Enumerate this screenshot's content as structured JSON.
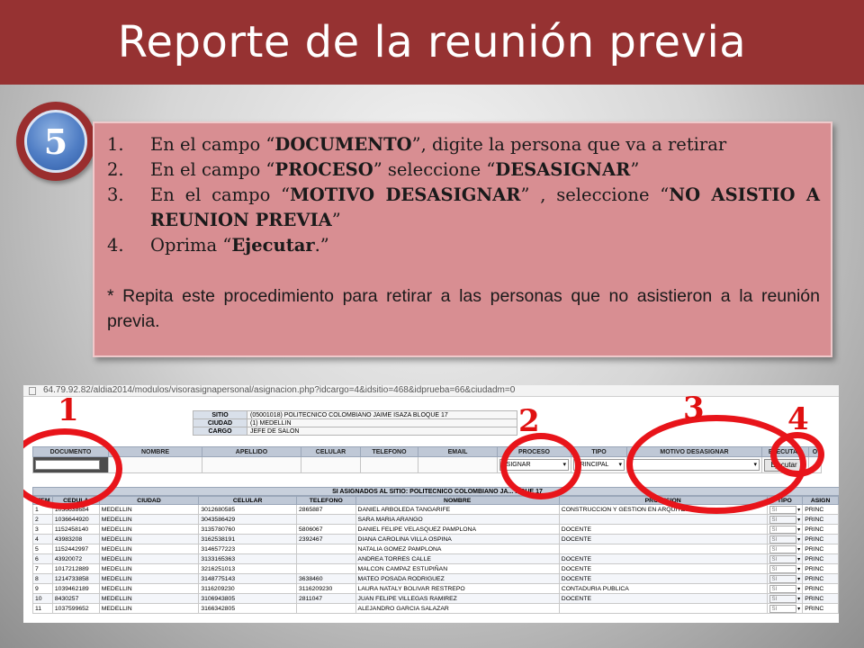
{
  "slide": {
    "title": "Reporte de la reunión previa",
    "step_number": "5"
  },
  "instructions": {
    "items": [
      {
        "num": "1.",
        "parts": [
          {
            "t": "En el campo “",
            "b": false
          },
          {
            "t": "DOCUMENTO",
            "b": true
          },
          {
            "t": "”, digite la persona que va a retirar",
            "b": false
          }
        ]
      },
      {
        "num": "2.",
        "parts": [
          {
            "t": "En el campo “",
            "b": false
          },
          {
            "t": "PROCESO",
            "b": true
          },
          {
            "t": "” seleccione “",
            "b": false
          },
          {
            "t": "DESASIGNAR",
            "b": true
          },
          {
            "t": "”",
            "b": false
          }
        ]
      },
      {
        "num": "3.",
        "parts": [
          {
            "t": "En el campo “",
            "b": false
          },
          {
            "t": "MOTIVO DESASIGNAR",
            "b": true
          },
          {
            "t": "” , seleccione “",
            "b": false
          },
          {
            "t": "NO ASISTIO A REUNION PREVIA",
            "b": true
          },
          {
            "t": "”",
            "b": false
          }
        ]
      },
      {
        "num": "4.",
        "parts": [
          {
            "t": "Oprima “",
            "b": false
          },
          {
            "t": "Ejecutar",
            "b": true
          },
          {
            "t": ".”",
            "b": false
          }
        ]
      }
    ],
    "note": "* Repita este procedimiento para retirar a las personas que no asistieron a la reunión previa."
  },
  "screenshot": {
    "url": "64.79.92.82/aldia2014/modulos/visorasignapersonal/asignacion.php?idcargo=4&idsitio=468&idprueba=66&ciudadm=0",
    "info": [
      {
        "label": "SITIO",
        "value": "(05001018) POLITECNICO COLOMBIANO JAIME ISAZA BLOQUE 17"
      },
      {
        "label": "CIUDAD",
        "value": "(1) MEDELLIN"
      },
      {
        "label": "CARGO",
        "value": "JEFE DE SALON"
      }
    ],
    "form_headers": [
      "DOCUMENTO",
      "NOMBRE",
      "APELLIDO",
      "CELULAR",
      "TELEFONO",
      "EMAIL",
      "PROCESO",
      "TIPO",
      "MOTIVO DESASIGNAR",
      "EJECUTAR",
      "O"
    ],
    "proceso_value": "ASIGNAR",
    "tipo_value": "PRINCIPAL",
    "execute_label": "Ejecutar",
    "list_title": "SI ASIGNADOS AL SITIO: POLITECNICO COLOMBIANO JA... ...QUE 17",
    "list_headers": [
      "ITEM",
      "CEDULA",
      "CIUDAD",
      "CELULAR",
      "TELEFONO",
      "NOMBRE",
      "PROFESION",
      "TIPO",
      "ASIGN"
    ],
    "rows": [
      [
        "1",
        "1036638684",
        "MEDELLIN",
        "3012680585",
        "2865887",
        "DANIEL ARBOLEDA TANGARIFE",
        "CONSTRUCCION Y GESTION EN ARQUITECTURA",
        "SI",
        "PRINC"
      ],
      [
        "2",
        "1036644920",
        "MEDELLIN",
        "3043586429",
        "",
        "SARA MARIA ARANGO",
        "",
        "SI",
        "PRINC"
      ],
      [
        "3",
        "1152458140",
        "MEDELLIN",
        "3135780760",
        "5806067",
        "DANIEL FELIPE VELASQUEZ PAMPLONA",
        "DOCENTE",
        "SI",
        "PRINC"
      ],
      [
        "4",
        "43983208",
        "MEDELLIN",
        "3162538191",
        "2392467",
        "DIANA CAROLINA VILLA OSPINA",
        "DOCENTE",
        "SI",
        "PRINC"
      ],
      [
        "5",
        "1152442997",
        "MEDELLIN",
        "3146577223",
        "",
        "NATALIA GOMEZ PAMPLONA",
        "",
        "SI",
        "PRINC"
      ],
      [
        "6",
        "43920072",
        "MEDELLIN",
        "3133165363",
        "",
        "ANDREA TORRES CALLE",
        "DOCENTE",
        "SI",
        "PRINC"
      ],
      [
        "7",
        "1017212889",
        "MEDELLIN",
        "3216251013",
        "",
        "MALCON CAMPAZ ESTUPIÑAN",
        "DOCENTE",
        "SI",
        "PRINC"
      ],
      [
        "8",
        "1214733858",
        "MEDELLIN",
        "3148775143",
        "3638460",
        "MATEO POSADA RODRIGUEZ",
        "DOCENTE",
        "SI",
        "PRINC"
      ],
      [
        "9",
        "1039462189",
        "MEDELLIN",
        "3116209230",
        "3116209230",
        "LAURA NATALY BOLIVAR RESTREPO",
        "CONTADURIA PUBLICA",
        "SI",
        "PRINC"
      ],
      [
        "10",
        "8430257",
        "MEDELLIN",
        "3106943805",
        "2811047",
        "JUAN FELIPE VILLEGAS RAMIREZ",
        "DOCENTE",
        "SI",
        "PRINC"
      ],
      [
        "11",
        "1037599652",
        "MEDELLIN",
        "3166342805",
        "",
        "ALEJANDRO GARCIA SALAZAR",
        "",
        "SI",
        "PRINC"
      ]
    ],
    "callouts": [
      "1",
      "2",
      "3",
      "4"
    ]
  },
  "colors": {
    "title_bar": "#963232",
    "callout_red": "#e8141a",
    "box_pink": "#d88e92"
  }
}
